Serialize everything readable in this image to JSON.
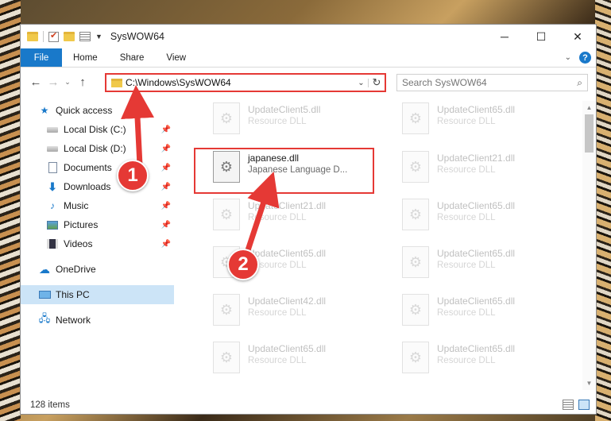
{
  "window": {
    "title": "SysWOW64",
    "controls": {
      "minimize": "─",
      "maximize": "☐",
      "close": "✕"
    }
  },
  "ribbon": {
    "file": "File",
    "tabs": [
      "Home",
      "Share",
      "View"
    ],
    "help": "?"
  },
  "address": {
    "path": "C:\\Windows\\SysWOW64",
    "search_placeholder": "Search SysWOW64"
  },
  "nav": {
    "items": [
      {
        "label": "Quick access",
        "icon": "star-icon"
      },
      {
        "label": "Local Disk (C:)",
        "icon": "drive-icon"
      },
      {
        "label": "Local Disk (D:)",
        "icon": "drive-icon"
      },
      {
        "label": "Documents",
        "icon": "documents-icon"
      },
      {
        "label": "Downloads",
        "icon": "download-icon"
      },
      {
        "label": "Music",
        "icon": "music-icon"
      },
      {
        "label": "Pictures",
        "icon": "pictures-icon"
      },
      {
        "label": "Videos",
        "icon": "videos-icon"
      },
      {
        "label": "OneDrive",
        "icon": "cloud-icon"
      },
      {
        "label": "This PC",
        "icon": "pc-icon"
      },
      {
        "label": "Network",
        "icon": "network-icon"
      }
    ]
  },
  "files": [
    {
      "name": "UpdateClient5.dll",
      "type": "Resource DLL"
    },
    {
      "name": "UpdateClient65.dll",
      "type": "Resource DLL"
    },
    {
      "name": "japanese.dll",
      "type": "Japanese Language D..."
    },
    {
      "name": "UpdateClient21.dll",
      "type": "Resource DLL"
    },
    {
      "name": "UpdateClient21.dll",
      "type": "Resource DLL"
    },
    {
      "name": "UpdateClient65.dll",
      "type": "Resource DLL"
    },
    {
      "name": "UpdateClient65.dll",
      "type": "Resource DLL"
    },
    {
      "name": "UpdateClient65.dll",
      "type": "Resource DLL"
    },
    {
      "name": "UpdateClient42.dll",
      "type": "Resource DLL"
    },
    {
      "name": "UpdateClient65.dll",
      "type": "Resource DLL"
    },
    {
      "name": "UpdateClient65.dll",
      "type": "Resource DLL"
    },
    {
      "name": "UpdateClient65.dll",
      "type": "Resource DLL"
    }
  ],
  "status": {
    "count": "128 items"
  },
  "annotations": {
    "step1": "1",
    "step2": "2"
  },
  "colors": {
    "accent": "#1979ca",
    "annotation": "#e53935",
    "selected": "#cce4f7"
  }
}
